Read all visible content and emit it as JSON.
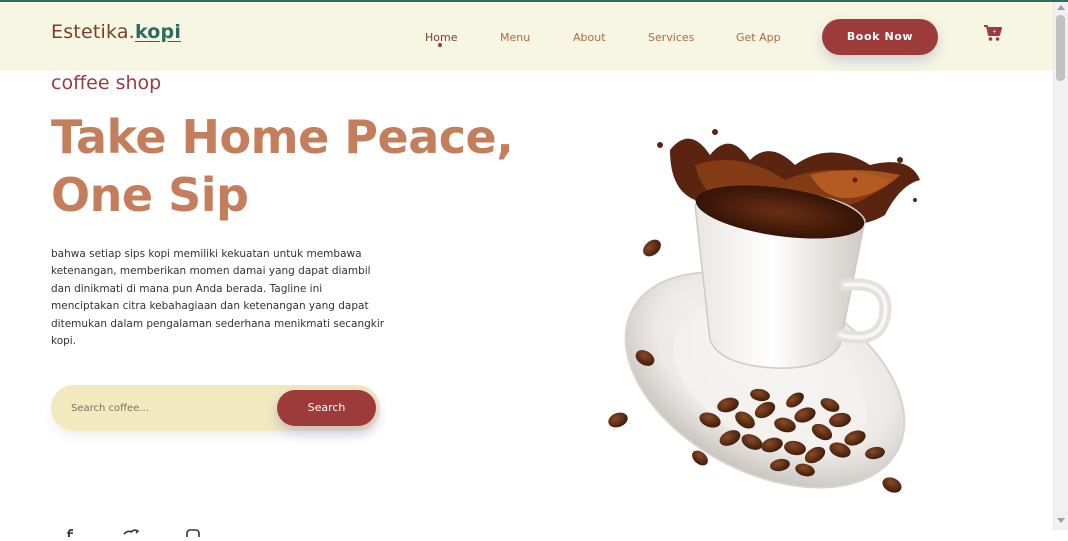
{
  "brand": {
    "name": "Estetika.",
    "accent": "kopi"
  },
  "nav": {
    "items": [
      {
        "label": "Home",
        "active": true
      },
      {
        "label": "Menu",
        "active": false
      },
      {
        "label": "About",
        "active": false
      },
      {
        "label": "Services",
        "active": false
      },
      {
        "label": "Get App",
        "active": false
      }
    ],
    "cta_label": "Book Now",
    "cart_icon": "cart-icon"
  },
  "hero": {
    "kicker": "coffee shop",
    "headline_line1": "Take Home Peace,",
    "headline_line2": "One Sip",
    "description": "bahwa setiap sips kopi memiliki kekuatan untuk membawa ketenangan, memberikan momen damai yang dapat diambil dan dinikmati di mana pun Anda berada. Tagline ini menciptakan citra kebahagiaan dan ketenangan yang dapat ditemukan dalam pengalaman sederhana menikmati secangkir kopi.",
    "image": "coffee-cup-splash"
  },
  "search": {
    "placeholder": "Search coffee...",
    "button_label": "Search"
  },
  "social": [
    "facebook-icon",
    "twitter-icon",
    "instagram-icon"
  ],
  "colors": {
    "nav_bg": "#f6f6e2",
    "primary": "#9d3a3a",
    "headline": "#c47e5c",
    "brand_accent": "#2f6b5f",
    "search_bg": "#f2e9bf"
  }
}
